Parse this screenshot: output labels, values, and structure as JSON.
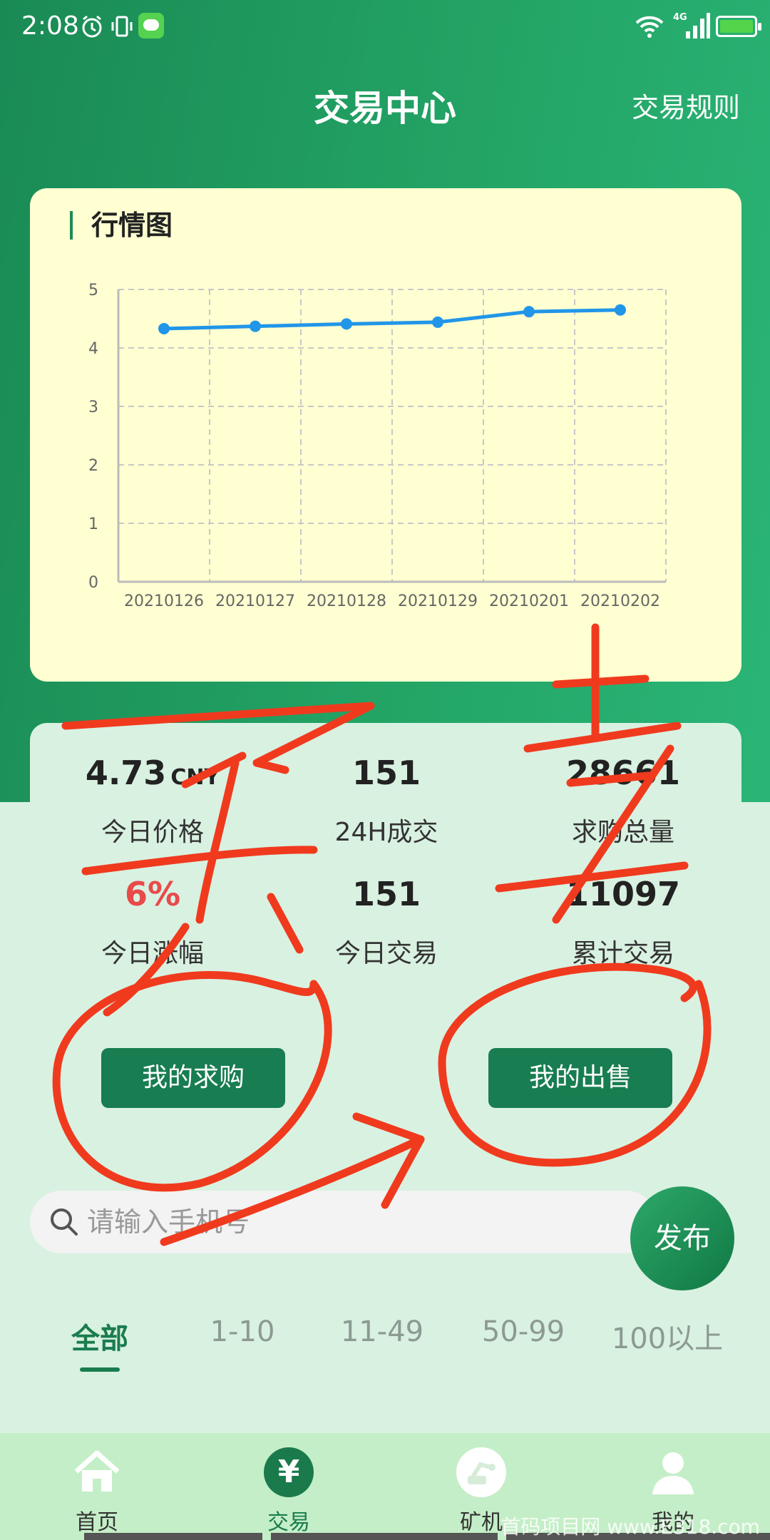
{
  "status_bar": {
    "time": "2:08",
    "network": "4G"
  },
  "header": {
    "title": "交易中心",
    "rules_link": "交易规则"
  },
  "chart_section": {
    "heading": "行情图",
    "chart_data": {
      "type": "line",
      "x": [
        "20210126",
        "20210127",
        "20210128",
        "20210129",
        "20210201",
        "20210202"
      ],
      "series": [
        {
          "values": [
            4.33,
            4.37,
            4.41,
            4.44,
            4.62,
            4.65
          ],
          "color": "#2196e8"
        }
      ],
      "ylim": [
        0,
        5
      ],
      "yticks": [
        0,
        1,
        2,
        3,
        4,
        5
      ],
      "grid": true
    }
  },
  "stats": {
    "price": {
      "value": "4.73",
      "unit": "CNY",
      "label": "今日价格"
    },
    "volume_24h": {
      "value": "151",
      "label": "24H成交"
    },
    "total_buy": {
      "value": "28661",
      "label": "求购总量"
    },
    "change": {
      "value": "6%",
      "label": "今日涨幅",
      "color": "#e94a4a"
    },
    "today_trades": {
      "value": "151",
      "label": "今日交易"
    },
    "cumulative": {
      "value": "11097",
      "label": "累计交易"
    }
  },
  "buttons": {
    "my_buy": "我的求购",
    "my_sell": "我的出售"
  },
  "search": {
    "placeholder": "请输入手机号",
    "value": ""
  },
  "publish_button": "发布",
  "tabs": [
    {
      "label": "全部",
      "active": true
    },
    {
      "label": "1-10"
    },
    {
      "label": "11-49"
    },
    {
      "label": "50-99"
    },
    {
      "label": "100以上"
    }
  ],
  "bottom_nav": [
    {
      "label": "首页",
      "icon": "home-icon"
    },
    {
      "label": "交易",
      "icon": "yen-icon",
      "active": true
    },
    {
      "label": "矿机",
      "icon": "mining-machine-icon"
    },
    {
      "label": "我的",
      "icon": "user-icon"
    }
  ],
  "watermark": "首码项目网 www.E318.com",
  "colors": {
    "primary": "#1a7c4e",
    "accent_red": "#e94a4a",
    "line": "#2196e8",
    "chart_bg": "#ffffd2",
    "annotation": "#f03a1e"
  }
}
